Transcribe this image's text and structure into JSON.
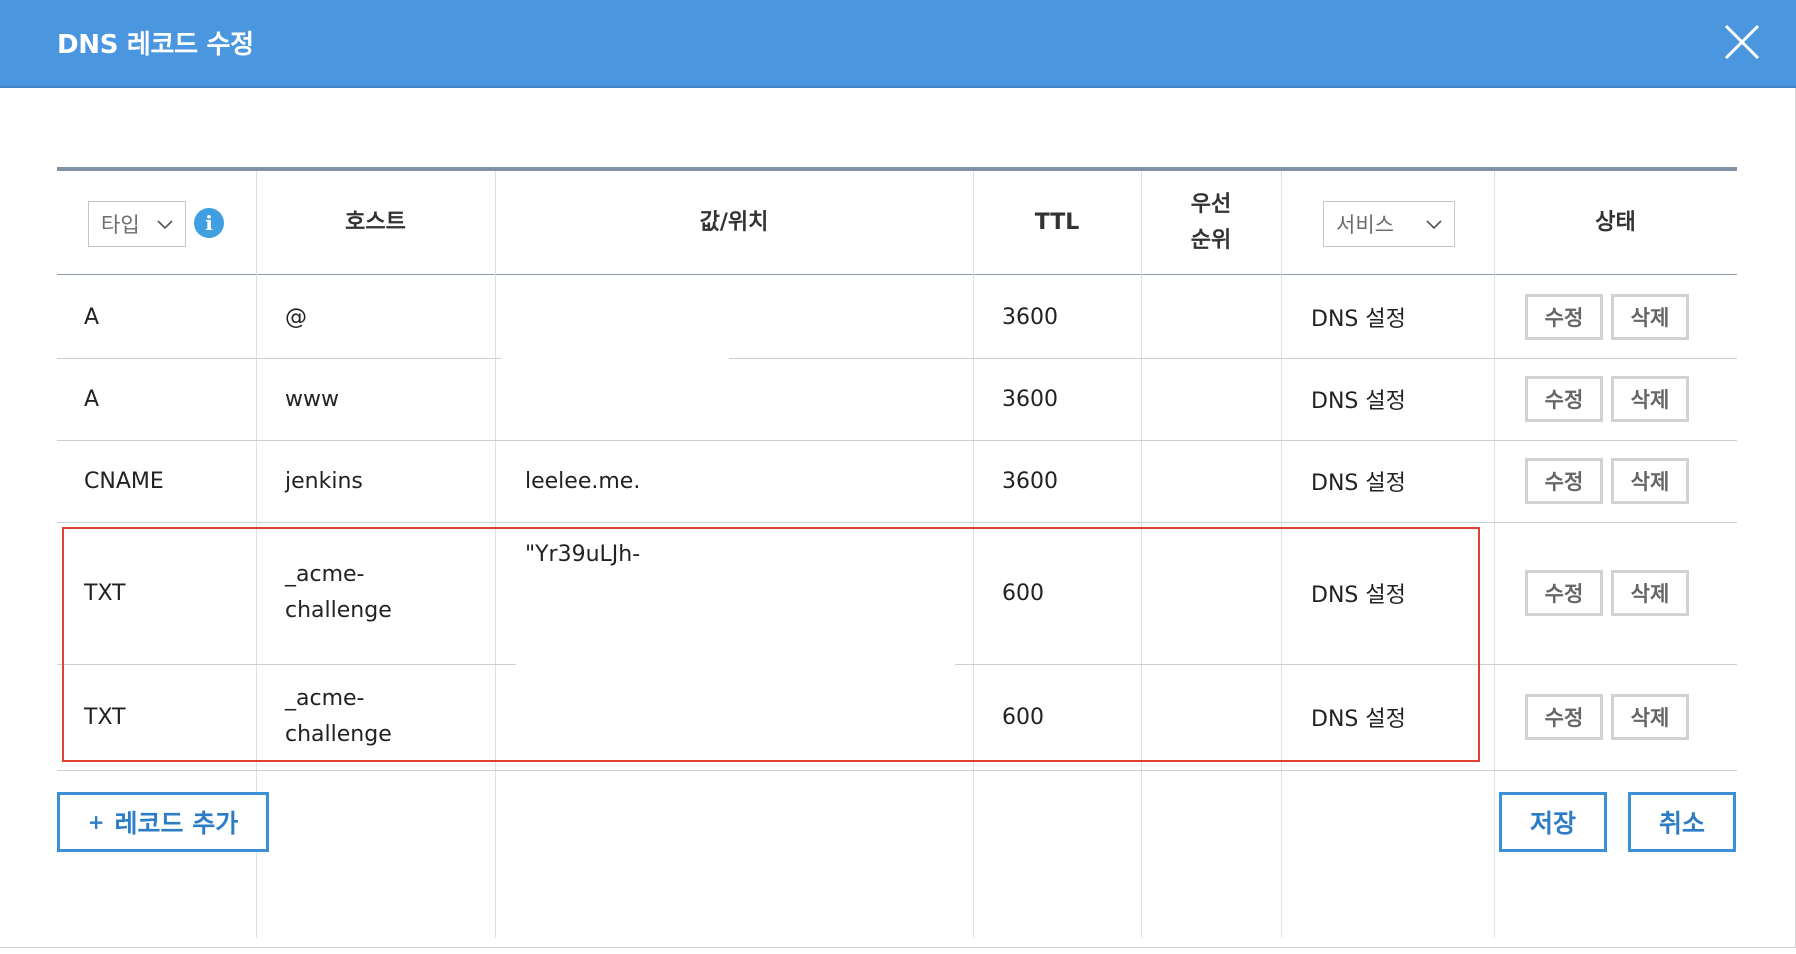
{
  "dialog": {
    "title": "DNS 레코드 수정",
    "close_icon": "close-icon"
  },
  "table": {
    "headers": {
      "type_select": "타입",
      "host": "호스트",
      "value": "값/위치",
      "ttl": "TTL",
      "priority_line1": "우선",
      "priority_line2": "순위",
      "service_select": "서비스",
      "status": "상태"
    },
    "rows": [
      {
        "type": "A",
        "host": "@",
        "value": "",
        "ttl": "3600",
        "priority": "",
        "service": "DNS 설정",
        "edit": "수정",
        "delete": "삭제"
      },
      {
        "type": "A",
        "host": "www",
        "value": "",
        "ttl": "3600",
        "priority": "",
        "service": "DNS 설정",
        "edit": "수정",
        "delete": "삭제"
      },
      {
        "type": "CNAME",
        "host": "jenkins",
        "value": "leelee.me.",
        "ttl": "3600",
        "priority": "",
        "service": "DNS 설정",
        "edit": "수정",
        "delete": "삭제"
      },
      {
        "type": "TXT",
        "host_line1": "_acme-",
        "host_line2": "challenge",
        "value": "\"Yr39uLJh-",
        "ttl": "600",
        "priority": "",
        "service": "DNS 설정",
        "edit": "수정",
        "delete": "삭제"
      },
      {
        "type": "TXT",
        "host_line1": "_acme-",
        "host_line2": "challenge",
        "value": "",
        "ttl": "600",
        "priority": "",
        "service": "DNS 설정",
        "edit": "수정",
        "delete": "삭제"
      }
    ]
  },
  "footer": {
    "add_record": "레코드 추가",
    "add_plus": "+",
    "save": "저장",
    "cancel": "취소"
  },
  "colors": {
    "header_bar": "#4a97df",
    "accent": "#3d8fd6",
    "highlight": "#e0402f"
  }
}
